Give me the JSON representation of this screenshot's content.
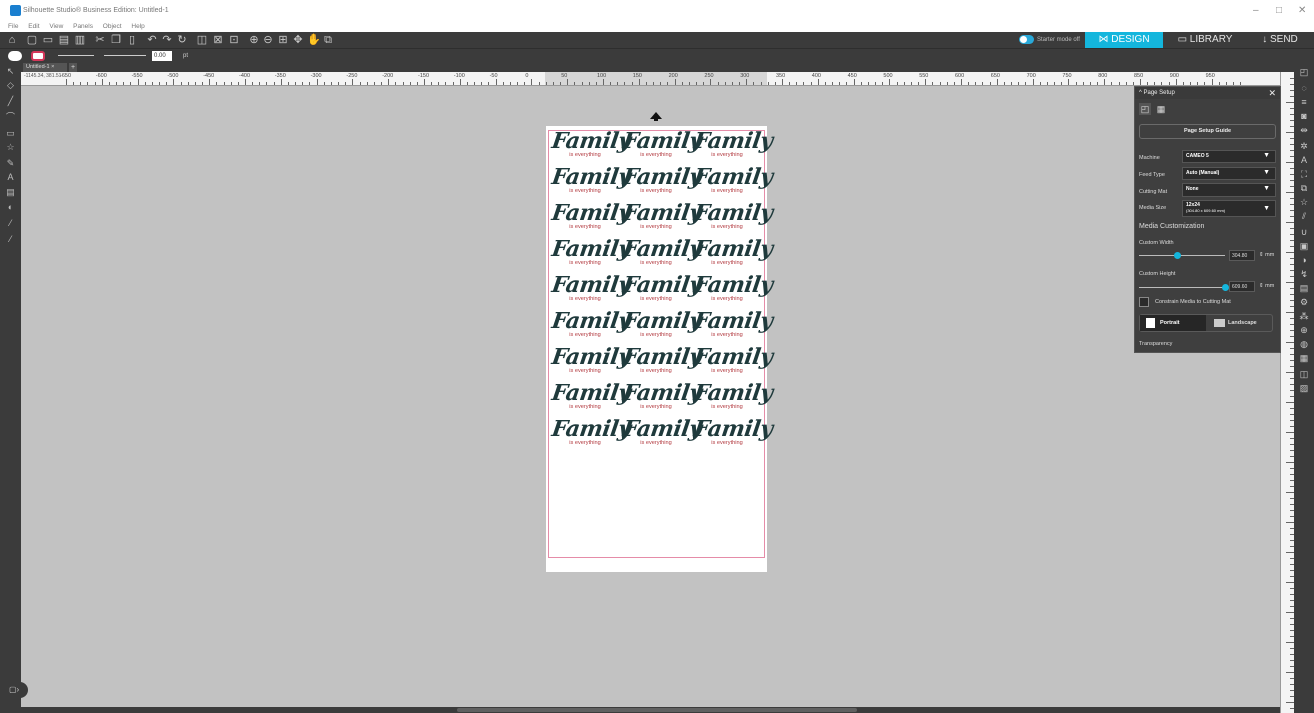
{
  "window": {
    "title": "Silhouette Studio® Business Edition: Untitled-1",
    "minimize": "–",
    "maximize": "□",
    "close": "✕"
  },
  "menu": [
    "File",
    "Edit",
    "View",
    "Panels",
    "Object",
    "Help"
  ],
  "toolbar": {
    "starter_mode_label": "Starter mode off",
    "tabs": {
      "design": "DESIGN",
      "library": "LIBRARY",
      "send": "SEND"
    },
    "design_icon": "⋈",
    "library_icon": "▭",
    "send_icon": "↓"
  },
  "propbar": {
    "line_width_value": "0.00",
    "unit": "pt"
  },
  "document": {
    "tab_label": "Untitled-1",
    "tab_close": "×",
    "add_tab": "+",
    "coordinates": "-1145.34, 381.51"
  },
  "ruler": {
    "labels": [
      "-650",
      "-600",
      "-550",
      "-500",
      "-450",
      "-400",
      "-350",
      "-300",
      "-250",
      "-200",
      "-150",
      "-100",
      "-50",
      "0",
      "50",
      "100",
      "150",
      "200",
      "250",
      "300",
      "350",
      "400",
      "450",
      "500",
      "550",
      "600",
      "650",
      "700",
      "750",
      "800",
      "850",
      "900",
      "950"
    ]
  },
  "canvas": {
    "design_title": "Family",
    "design_subtitle": "is everything",
    "grid_rows": 9,
    "grid_cols": 3,
    "colors": {
      "title": "#1f3a3c",
      "subtitle": "#b2393f",
      "cut_border": "#e58ca8"
    }
  },
  "page_setup": {
    "title": "Page Setup",
    "guide_button": "Page Setup Guide",
    "machine_label": "Machine",
    "machine_value": "CAMEO 5",
    "feed_label": "Feed Type",
    "feed_value": "Auto (Manual)",
    "mat_label": "Cutting Mat",
    "mat_value": "None",
    "media_label": "Media Size",
    "media_value_line1": "12x24",
    "media_value_line2": "(304.80 x 609.60 mm)",
    "customization_heading": "Media Customization",
    "width_label": "Custom Width",
    "width_value": "304.80",
    "width_fraction": 0.45,
    "height_label": "Custom Height",
    "height_value": "609.60",
    "height_fraction": 1.0,
    "unit": "mm",
    "constrain_label": "Constrain Media to Cutting Mat",
    "portrait_label": "Portrait",
    "landscape_label": "Landscape",
    "transparency_label": "Transparency"
  },
  "accent_color": "#14b6dd"
}
